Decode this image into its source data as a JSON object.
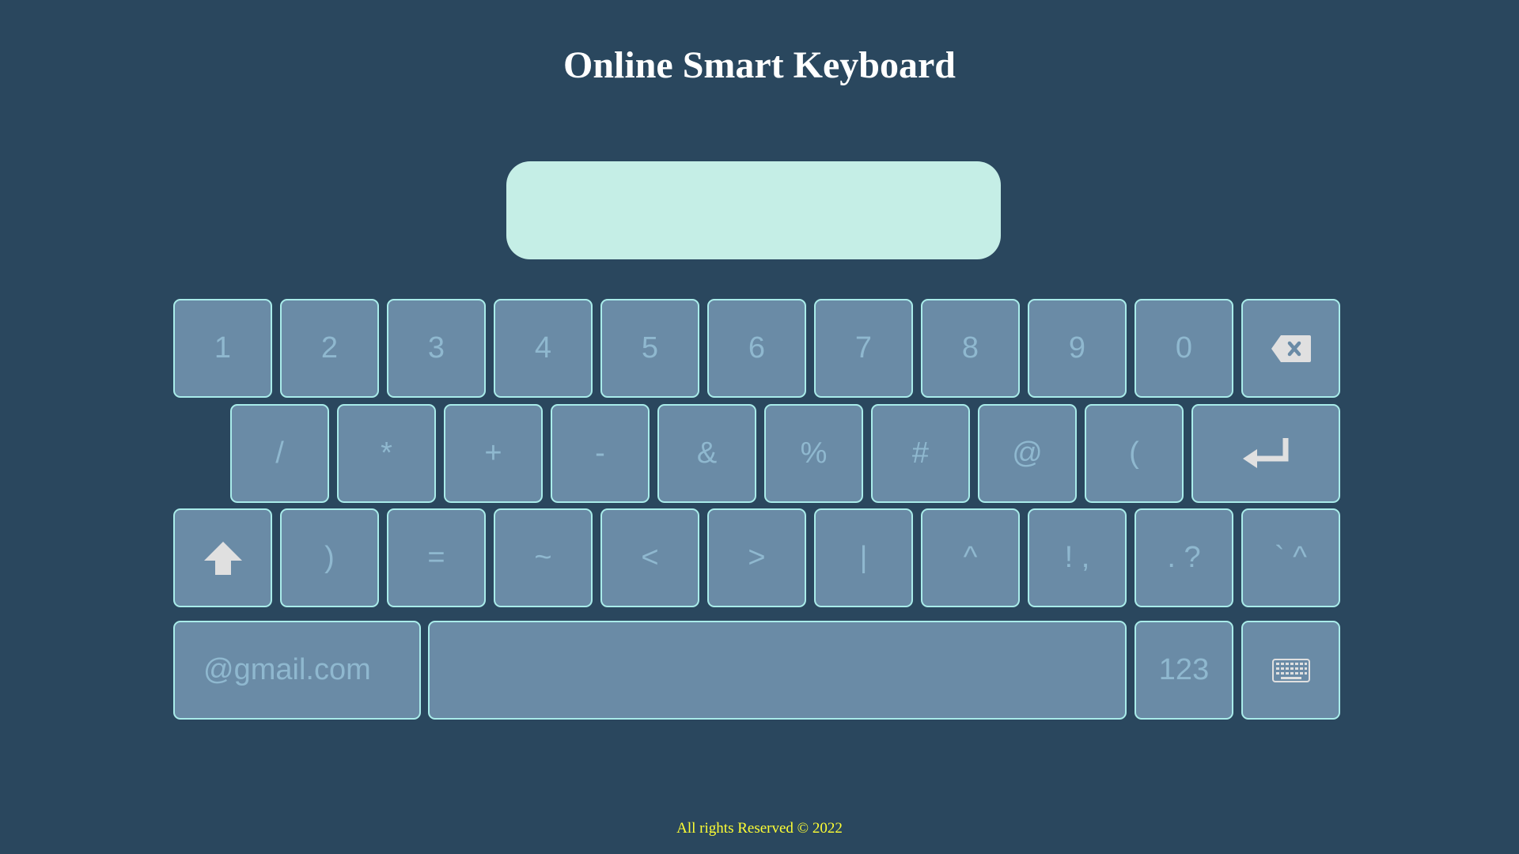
{
  "page": {
    "title": "Online Smart Keyboard",
    "footer": "All rights Reserved © 2022"
  },
  "display": {
    "value": "",
    "placeholder": ""
  },
  "keyboard": {
    "row1": [
      "1",
      "2",
      "3",
      "4",
      "5",
      "6",
      "7",
      "8",
      "9",
      "0"
    ],
    "row1_end_icon": "backspace-icon",
    "row2": [
      "/",
      "*",
      "+",
      "-",
      "&",
      "%",
      "#",
      "@",
      "("
    ],
    "row2_end_icon": "enter-icon",
    "row3_start_icon": "shift-icon",
    "row3": [
      ")",
      "=",
      "~",
      "<",
      ">",
      "|",
      "^",
      "! ,",
      ". ?",
      "` ^"
    ],
    "row4": {
      "email_label": "@gmail.com",
      "space_label": "",
      "numbers_label": "123",
      "keyboard_icon": "keyboard-icon"
    }
  },
  "colors": {
    "background": "#2a475e",
    "display": "#c5eee6",
    "key": "#6a8ba6",
    "key_border": "#a9ecea",
    "key_text": "#8fb8cf",
    "icon": "#e0e0e0",
    "footer_text": "#ffff33"
  }
}
